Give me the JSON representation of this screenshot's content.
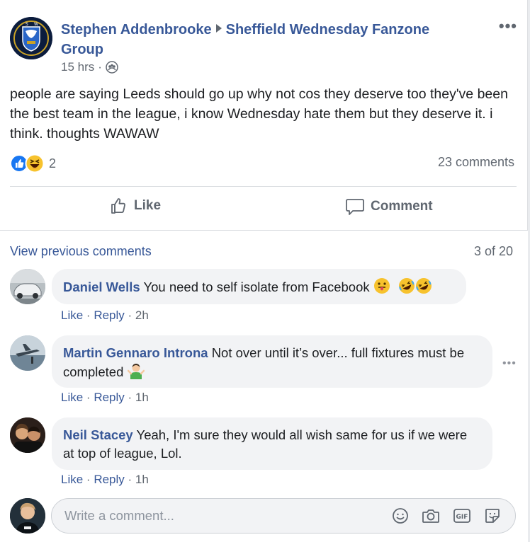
{
  "post": {
    "author": "Stephen Addenbrooke",
    "group": "Sheffield Wednesday Fanzone Group",
    "time": "15 hrs",
    "text": "people are saying Leeds should go up why not cos they deserve too they've been the best team in the league, i know Wednesday hate them but they deserve it. i think. thoughts WAWAW",
    "reaction_count": "2",
    "comments_count": "23 comments",
    "icons": {
      "group_avatar": "sheffield-wednesday-crest",
      "privacy": "group-members-icon",
      "more": "more-options-icon"
    }
  },
  "actions": {
    "like_label": "Like",
    "comment_label": "Comment"
  },
  "comments_header": {
    "view_previous": "View previous comments",
    "page_count": "3 of 20"
  },
  "comments": [
    {
      "author": "Daniel Wells",
      "text": "You need to self isolate from Facebook",
      "like": "Like",
      "reply": "Reply",
      "time": "2h"
    },
    {
      "author": "Martin Gennaro Introna",
      "text": "Not over until it’s over... full fixtures must be completed",
      "like": "Like",
      "reply": "Reply",
      "time": "1h"
    },
    {
      "author": "Neil Stacey",
      "text": "Yeah, I'm sure they would all wish same for us if we were at top of league, Lol.",
      "like": "Like",
      "reply": "Reply",
      "time": "1h"
    }
  ],
  "write_comment": {
    "placeholder": "Write a comment..."
  },
  "colors": {
    "link_blue": "#385898",
    "meta_grey": "#606770",
    "bubble_bg": "#f2f3f5",
    "like_blue": "#1877f2",
    "haha_yellow": "#f7c22d"
  }
}
